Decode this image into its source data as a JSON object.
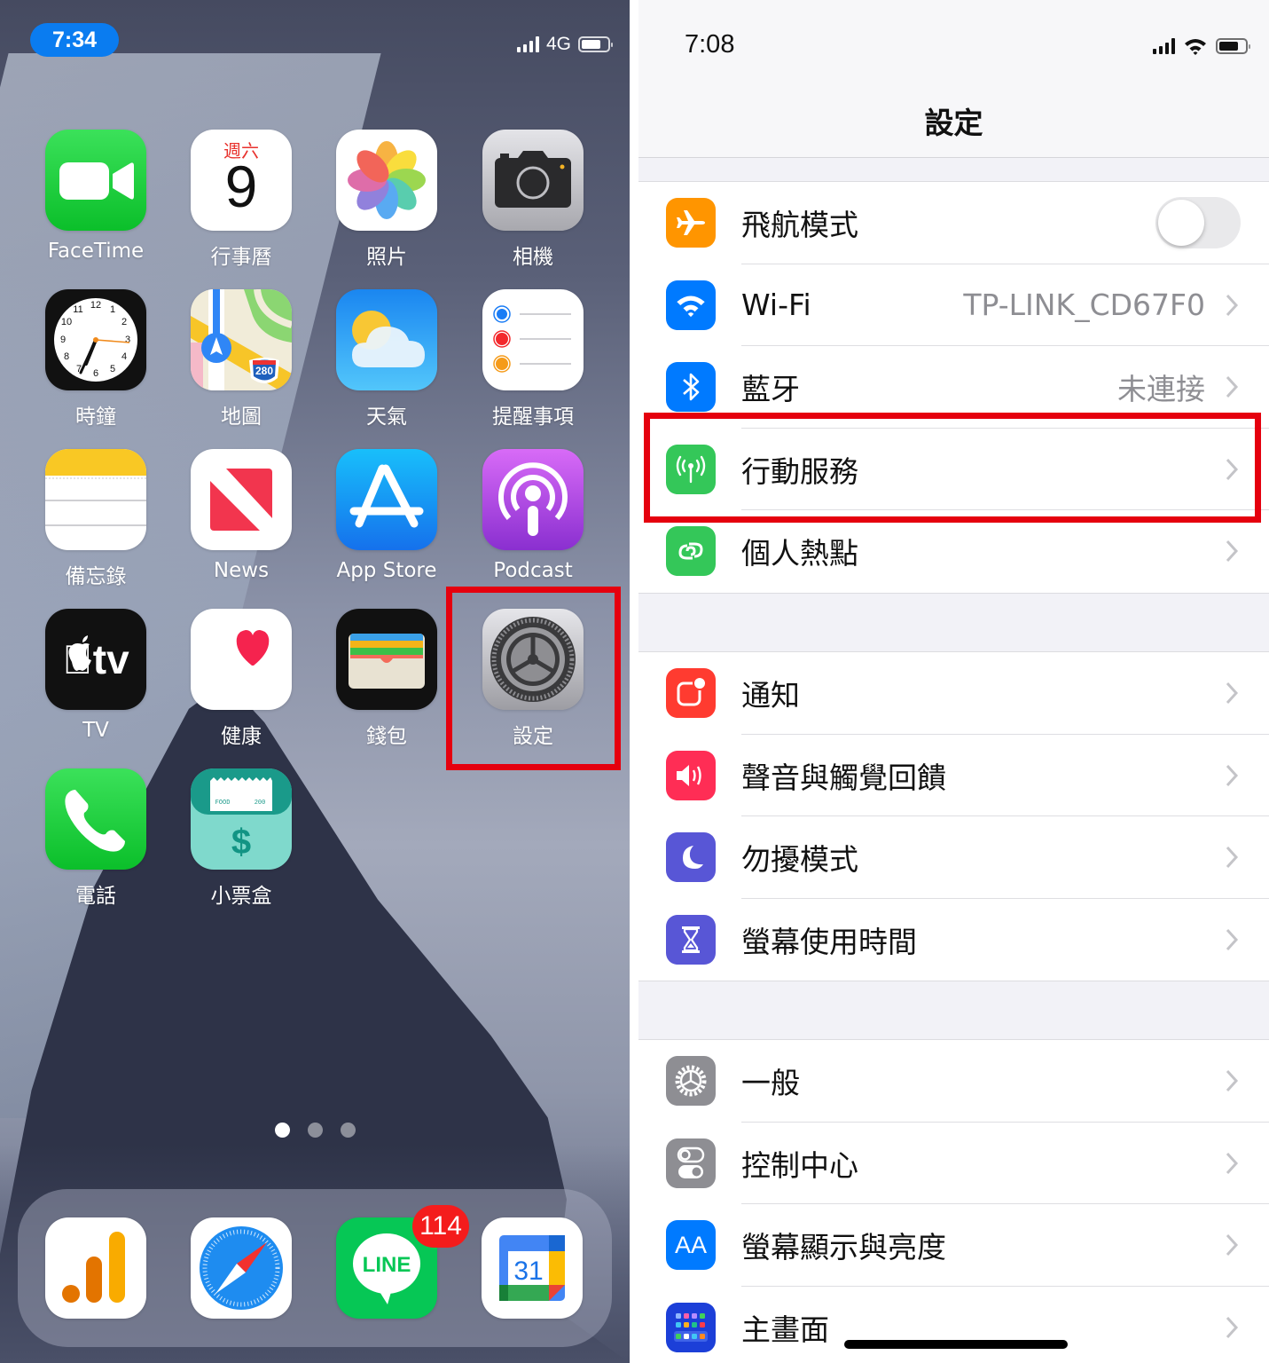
{
  "home_screen": {
    "status_bar": {
      "time": "7:34",
      "network": "4G",
      "signal_bars": 4
    },
    "apps": [
      {
        "id": "facetime",
        "label": "FaceTime"
      },
      {
        "id": "calendar",
        "label": "行事曆",
        "weekday": "週六",
        "day": "9"
      },
      {
        "id": "photos",
        "label": "照片"
      },
      {
        "id": "camera",
        "label": "相機"
      },
      {
        "id": "clock",
        "label": "時鐘"
      },
      {
        "id": "maps",
        "label": "地圖",
        "shield": "280"
      },
      {
        "id": "weather",
        "label": "天氣"
      },
      {
        "id": "reminders",
        "label": "提醒事項"
      },
      {
        "id": "notes",
        "label": "備忘錄"
      },
      {
        "id": "news",
        "label": "News"
      },
      {
        "id": "appstore",
        "label": "App Store"
      },
      {
        "id": "podcast",
        "label": "Podcast"
      },
      {
        "id": "tv",
        "label": "TV",
        "glyph": "tv"
      },
      {
        "id": "health",
        "label": "健康"
      },
      {
        "id": "wallet",
        "label": "錢包"
      },
      {
        "id": "settings",
        "label": "設定"
      },
      {
        "id": "phone",
        "label": "電話"
      },
      {
        "id": "receipt",
        "label": "小票盒",
        "ticket_left": "FOOD",
        "ticket_right": "200",
        "symbol": "$"
      }
    ],
    "page_indicator": {
      "pages": 3,
      "current": 1
    },
    "dock": [
      {
        "id": "analytics",
        "label": "Analytics"
      },
      {
        "id": "safari",
        "label": "Safari"
      },
      {
        "id": "line",
        "label": "LINE",
        "badge": "114"
      },
      {
        "id": "google-calendar",
        "label": "Google Calendar",
        "day": "31"
      }
    ],
    "highlighted_app": "settings"
  },
  "settings_screen": {
    "status_bar": {
      "time": "7:08",
      "signal_bars": 4
    },
    "title": "設定",
    "groups": [
      {
        "rows": [
          {
            "id": "airplane",
            "label": "飛航模式",
            "icon": "airplane-icon",
            "color": "#ff9500",
            "toggle": false
          },
          {
            "id": "wifi",
            "label": "Wi-Fi",
            "icon": "wifi-icon",
            "color": "#007aff",
            "value": "TP-LINK_CD67F0"
          },
          {
            "id": "bluetooth",
            "label": "藍牙",
            "icon": "bluetooth-icon",
            "color": "#007aff",
            "value": "未連接"
          },
          {
            "id": "cellular",
            "label": "行動服務",
            "icon": "antenna-icon",
            "color": "#34c759",
            "highlighted": true
          },
          {
            "id": "hotspot",
            "label": "個人熱點",
            "icon": "hotspot-icon",
            "color": "#34c759"
          }
        ]
      },
      {
        "rows": [
          {
            "id": "notifications",
            "label": "通知",
            "icon": "notification-icon",
            "color": "#ff3b30"
          },
          {
            "id": "sounds",
            "label": "聲音與觸覺回饋",
            "icon": "speaker-icon",
            "color": "#ff2d55"
          },
          {
            "id": "dnd",
            "label": "勿擾模式",
            "icon": "moon-icon",
            "color": "#5856d6"
          },
          {
            "id": "screentime",
            "label": "螢幕使用時間",
            "icon": "hourglass-icon",
            "color": "#5856d6"
          }
        ]
      },
      {
        "rows": [
          {
            "id": "general",
            "label": "一般",
            "icon": "gear-icon",
            "color": "#8e8e93"
          },
          {
            "id": "control",
            "label": "控制中心",
            "icon": "switches-icon",
            "color": "#8e8e93"
          },
          {
            "id": "display",
            "label": "螢幕顯示與亮度",
            "icon": "text-size-icon",
            "color": "#007aff",
            "glyph": "AA"
          },
          {
            "id": "homescreen",
            "label": "主畫面",
            "icon": "home-grid-icon",
            "color": "#1c3fd8"
          }
        ]
      }
    ]
  },
  "colors": {
    "highlight": "#e5000e",
    "time_pill": "#0a7cf0",
    "badge": "#f41c1c"
  }
}
